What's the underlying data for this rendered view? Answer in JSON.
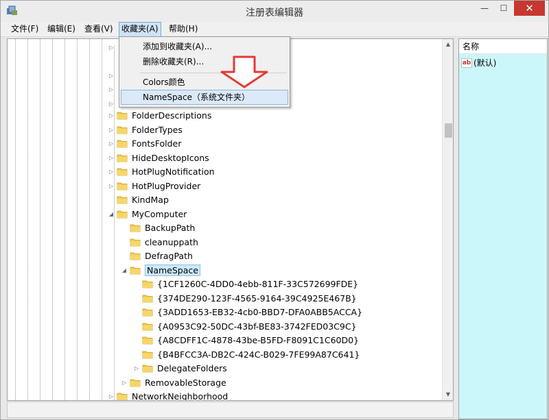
{
  "window": {
    "title": "注册表编辑器",
    "close_glyph": "✕",
    "max_glyph": "☐",
    "min_glyph": "—"
  },
  "menubar": {
    "items": [
      {
        "label": "文件(F)"
      },
      {
        "label": "编辑(E)"
      },
      {
        "label": "查看(V)"
      },
      {
        "label": "收藏夹(A)"
      },
      {
        "label": "帮助(H)"
      }
    ]
  },
  "favorites_menu": {
    "items": [
      {
        "label": "添加到收藏夹(A)..."
      },
      {
        "label": "删除收藏夹(R)..."
      },
      {
        "label": "Colors颜色"
      },
      {
        "label": "NameSpace（系统文件夹）"
      }
    ]
  },
  "tree": {
    "rows": [
      {
        "label": "FolderDescriptions",
        "expander": "▷"
      },
      {
        "label": "FolderTypes",
        "expander": "▷"
      },
      {
        "label": "FontsFolder",
        "expander": "▷"
      },
      {
        "label": "HideDesktopIcons",
        "expander": "▷"
      },
      {
        "label": "HotPlugNotification",
        "expander": "▷"
      },
      {
        "label": "HotPlugProvider",
        "expander": "▷"
      },
      {
        "label": "KindMap",
        "expander": ""
      },
      {
        "label": "MyComputer",
        "expander": "◢"
      },
      {
        "label": "BackupPath",
        "expander": ""
      },
      {
        "label": "cleanuppath",
        "expander": ""
      },
      {
        "label": "DefragPath",
        "expander": ""
      },
      {
        "label": "NameSpace",
        "expander": "◢"
      },
      {
        "label": "{1CF1260C-4DD0-4ebb-811F-33C572699FDE}",
        "expander": ""
      },
      {
        "label": "{374DE290-123F-4565-9164-39C4925E467B}",
        "expander": ""
      },
      {
        "label": "{3ADD1653-EB32-4cb0-BBD7-DFA0ABB5ACCA}",
        "expander": ""
      },
      {
        "label": "{A0953C92-50DC-43bf-BE83-3742FED03C9C}",
        "expander": ""
      },
      {
        "label": "{A8CDFF1C-4878-43be-B5FD-F8091C1C60D0}",
        "expander": ""
      },
      {
        "label": "{B4BFCC3A-DB2C-424C-B029-7FE99A87C641}",
        "expander": ""
      },
      {
        "label": "DelegateFolders",
        "expander": "▷"
      },
      {
        "label": "RemovableStorage",
        "expander": "▷"
      },
      {
        "label": "NetworkNeighborhood",
        "expander": "▷"
      }
    ],
    "hidden_expanders": [
      "▷",
      "▷",
      "▷",
      "▷"
    ]
  },
  "values": {
    "column_name": "名称",
    "rows": [
      {
        "icon": "ab",
        "name": "(默认)"
      }
    ]
  },
  "colors": {
    "values_bg": "#ccf7fa",
    "selection": "#cce8ff",
    "close_red": "#c7372f",
    "folder": "#f2c94c",
    "annot_red": "#e53935"
  }
}
